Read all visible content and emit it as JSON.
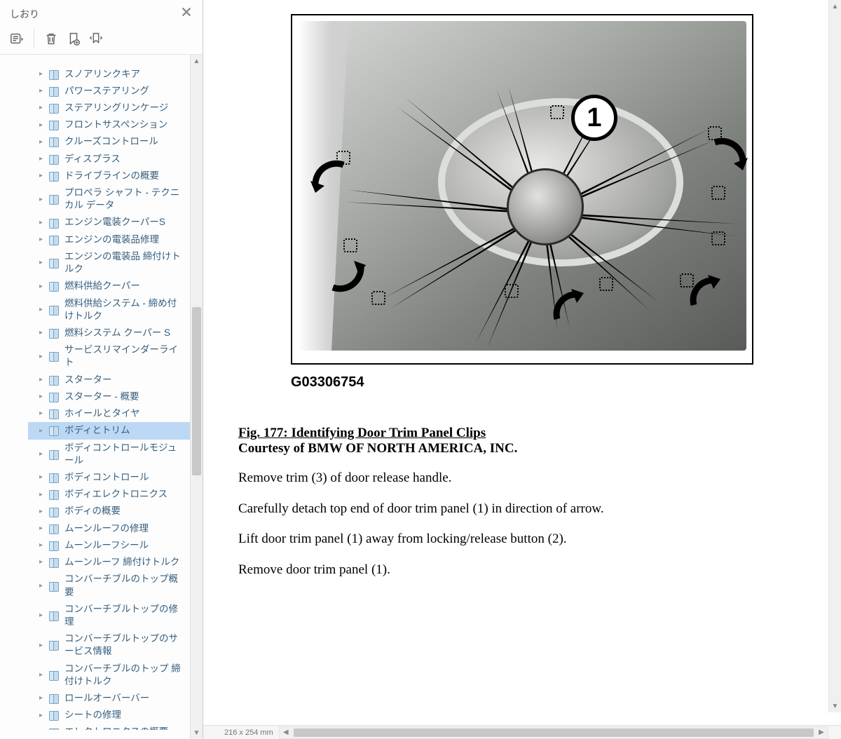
{
  "sidebar": {
    "title": "しおり",
    "items": [
      {
        "label": "スノアリンクキア"
      },
      {
        "label": "パワーステアリング"
      },
      {
        "label": "ステアリングリンケージ"
      },
      {
        "label": "フロントサスペンション"
      },
      {
        "label": "クルーズコントロール"
      },
      {
        "label": "ディスプラス"
      },
      {
        "label": "ドライブラインの概要"
      },
      {
        "label": "プロペラ シャフト - テクニカル データ"
      },
      {
        "label": "エンジン電装クーパーS"
      },
      {
        "label": "エンジンの電装品修理"
      },
      {
        "label": "エンジンの電装品  締付けトルク"
      },
      {
        "label": "燃料供給クーパー"
      },
      {
        "label": "燃料供給システム - 締め付けトルク"
      },
      {
        "label": "燃料システム クーパー S"
      },
      {
        "label": "サービスリマインダーライト"
      },
      {
        "label": "スターター"
      },
      {
        "label": "スターター - 概要"
      },
      {
        "label": "ホイールとタイヤ"
      },
      {
        "label": "ボディとトリム",
        "selected": true
      },
      {
        "label": "ボディコントロールモジュール"
      },
      {
        "label": "ボディコントロール"
      },
      {
        "label": "ボディエレクトロニクス"
      },
      {
        "label": "ボディの概要"
      },
      {
        "label": "ムーンルーフの修理"
      },
      {
        "label": "ムーンルーフシール"
      },
      {
        "label": "ムーンルーフ  締付けトルク"
      },
      {
        "label": "コンバーチブルのトップ概要"
      },
      {
        "label": "コンバーチブルトップの修理"
      },
      {
        "label": "コンバーチブルトップのサービス情報"
      },
      {
        "label": "コンバーチブルのトップ  締付けトルク"
      },
      {
        "label": "ロールオーバーバー"
      },
      {
        "label": "シートの修理"
      },
      {
        "label": "エレクトロニクスの概要"
      }
    ]
  },
  "document": {
    "figure_code": "G03306754",
    "figure_title": "Fig. 177: Identifying Door Trim Panel Clips",
    "figure_credit": "Courtesy of BMW OF NORTH AMERICA, INC.",
    "callout_number": "1",
    "paragraphs": [
      "Remove trim (3) of door release handle.",
      "Carefully detach top end of door trim panel (1) in direction of arrow.",
      "Lift door trim panel (1) away from locking/release button (2).",
      "Remove door trim panel (1)."
    ]
  },
  "statusbar": {
    "dimensions": "216 x 254 mm"
  }
}
